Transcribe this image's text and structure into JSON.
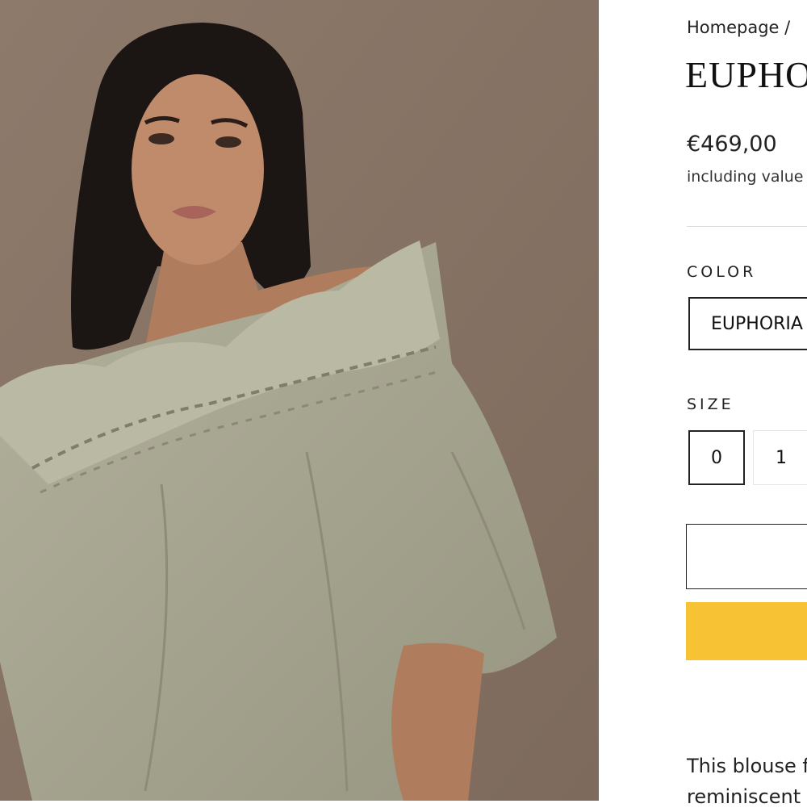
{
  "breadcrumb": {
    "home": "Homepage",
    "separator": "/"
  },
  "product": {
    "title": "EUPHO",
    "price": "€469,00",
    "price_note": "including value"
  },
  "color": {
    "label": "COLOR",
    "selected": "EUPHORIA"
  },
  "size": {
    "label": "SIZE",
    "options": [
      "0",
      "1"
    ],
    "selected": "0"
  },
  "description": {
    "line1": "This blouse fr",
    "line2": "reminiscent o"
  },
  "colors": {
    "accent": "#f7c234",
    "photo_background": "#8a7566",
    "garment": "#a6a58f"
  }
}
